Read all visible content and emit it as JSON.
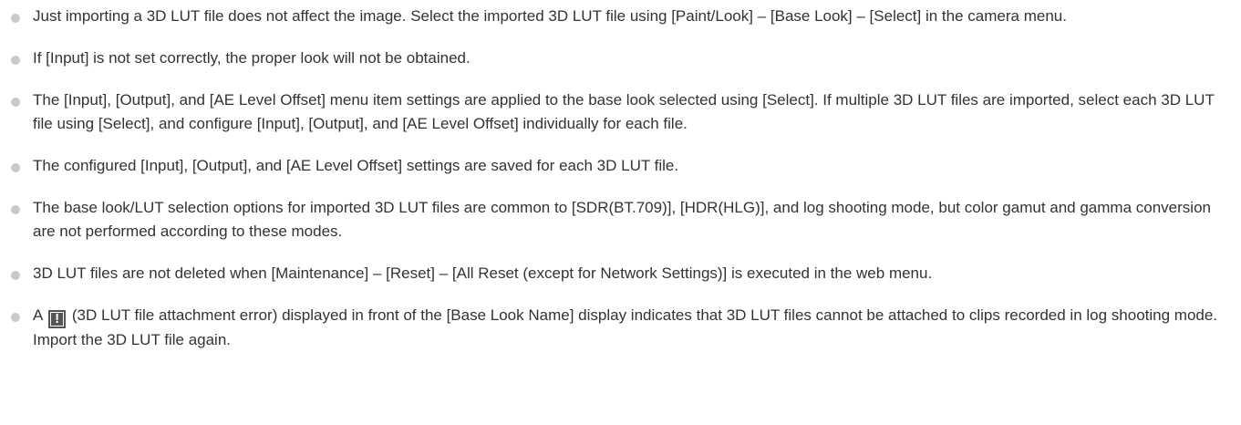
{
  "notes": [
    {
      "text": "Just importing a 3D LUT file does not affect the image. Select the imported 3D LUT file using [Paint/Look] – [Base Look] – [Select] in the camera menu."
    },
    {
      "text": "If [Input] is not set correctly, the proper look will not be obtained."
    },
    {
      "text": "The [Input], [Output], and [AE Level Offset] menu item settings are applied to the base look selected using [Select]. If multiple 3D LUT files are imported, select each 3D LUT file using [Select], and configure [Input], [Output], and [AE Level Offset] individually for each file."
    },
    {
      "text": "The configured [Input], [Output], and [AE Level Offset] settings are saved for each 3D LUT file."
    },
    {
      "text": "The base look/LUT selection options for imported 3D LUT files are common to [SDR(BT.709)], [HDR(HLG)], and log shooting mode, but color gamut and gamma conversion are not performed according to these modes."
    },
    {
      "text": "3D LUT files are not deleted when [Maintenance] – [Reset] – [All Reset (except for Network Settings)] is executed in the web menu."
    }
  ],
  "last_note": {
    "before_icon": "A",
    "icon": "exclamation-icon",
    "icon_glyph": "!",
    "after_icon": "(3D LUT file attachment error) displayed in front of the [Base Look Name] display indicates that 3D LUT files cannot be attached to clips recorded in log shooting mode. Import the 3D LUT file again."
  }
}
